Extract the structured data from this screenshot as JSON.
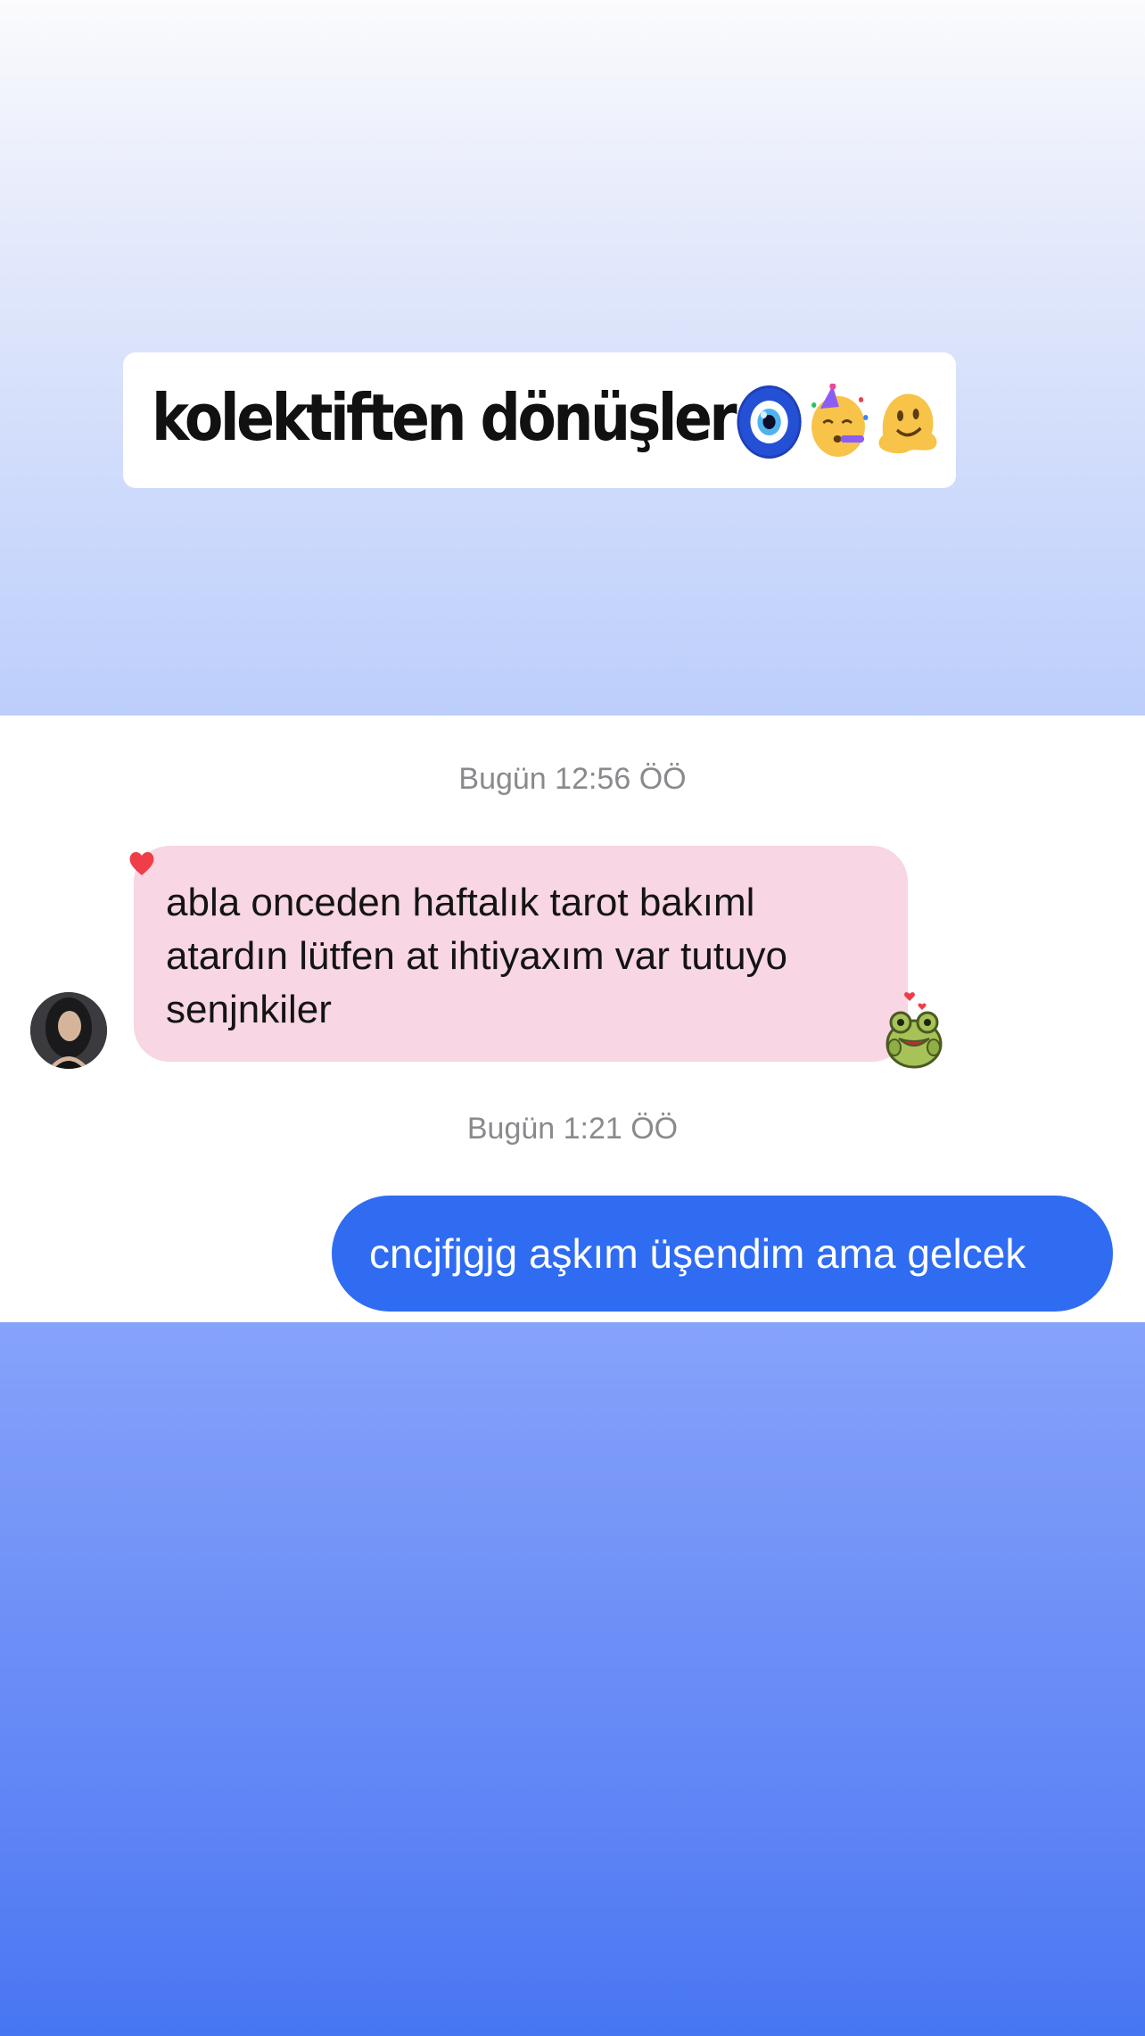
{
  "story": {
    "caption": "kolektiften dönüşler",
    "caption_emojis": [
      "nazar-amulet-icon",
      "partying-face-icon",
      "melting-face-icon"
    ]
  },
  "chat": {
    "timestamps": [
      "Bugün 12:56 ÖÖ",
      "Bugün 1:21 ÖÖ"
    ],
    "received_message": {
      "text": "abla onceden haftalık tarot bakıml atardın lütfen at ihtiyaxım var tutuyo senjnkiler",
      "reaction": "heart-icon",
      "bubble_color": "#f8d6e3"
    },
    "sent_message": {
      "text": "cncjfjgjg aşkım üşendim ama gelcek",
      "bubble_color": "#2f6cf2"
    }
  },
  "colors": {
    "top_gradient_start": "#fbfbfd",
    "top_gradient_end": "#bccefb",
    "bottom_gradient_start": "#86a3fa",
    "bottom_gradient_end": "#4776f2"
  }
}
